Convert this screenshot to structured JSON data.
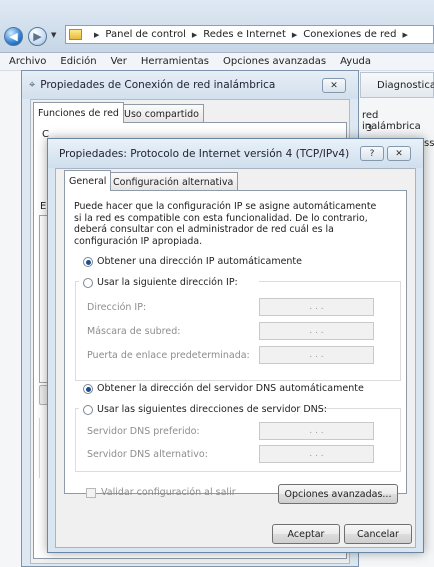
{
  "explorer": {
    "breadcrumb": [
      "Panel de control",
      "Redes e Internet",
      "Conexiones de red"
    ],
    "menu": [
      "Archivo",
      "Edición",
      "Ver",
      "Herramientas",
      "Opciones avanzadas",
      "Ayuda"
    ],
    "bg_tab": "Diagnostica",
    "bg_text": [
      "red inalámbrica",
      "3",
      "ss"
    ]
  },
  "window1": {
    "title": "Propiedades de Conexión de red inalámbrica",
    "close_label": "✕",
    "tabs": [
      "Funciones de red",
      "Uso compartido"
    ],
    "partial_labels": [
      "C",
      "E"
    ]
  },
  "dialog": {
    "title": "Propiedades: Protocolo de Internet versión 4 (TCP/IPv4)",
    "help_label": "?",
    "close_label": "✕",
    "tabs": [
      "General",
      "Configuración alternativa"
    ],
    "description": "Puede hacer que la configuración IP se asigne automáticamente si la red es compatible con esta funcionalidad. De lo contrario, deberá consultar con el administrador de red cuál es la configuración IP apropiada.",
    "ip_auto": "Obtener una dirección IP automáticamente",
    "ip_manual": "Usar la siguiente dirección IP:",
    "ip_fields": [
      "Dirección IP:",
      "Máscara de subred:",
      "Puerta de enlace predeterminada:"
    ],
    "dns_auto": "Obtener la dirección del servidor DNS automáticamente",
    "dns_manual": "Usar las siguientes direcciones de servidor DNS:",
    "dns_fields": [
      "Servidor DNS preferido:",
      "Servidor DNS alternativo:"
    ],
    "ip_placeholder_dots": ".     .     .",
    "validate_label": "Validar configuración al salir",
    "advanced_button": "Opciones avanzadas...",
    "ok_button": "Aceptar",
    "cancel_button": "Cancelar"
  }
}
